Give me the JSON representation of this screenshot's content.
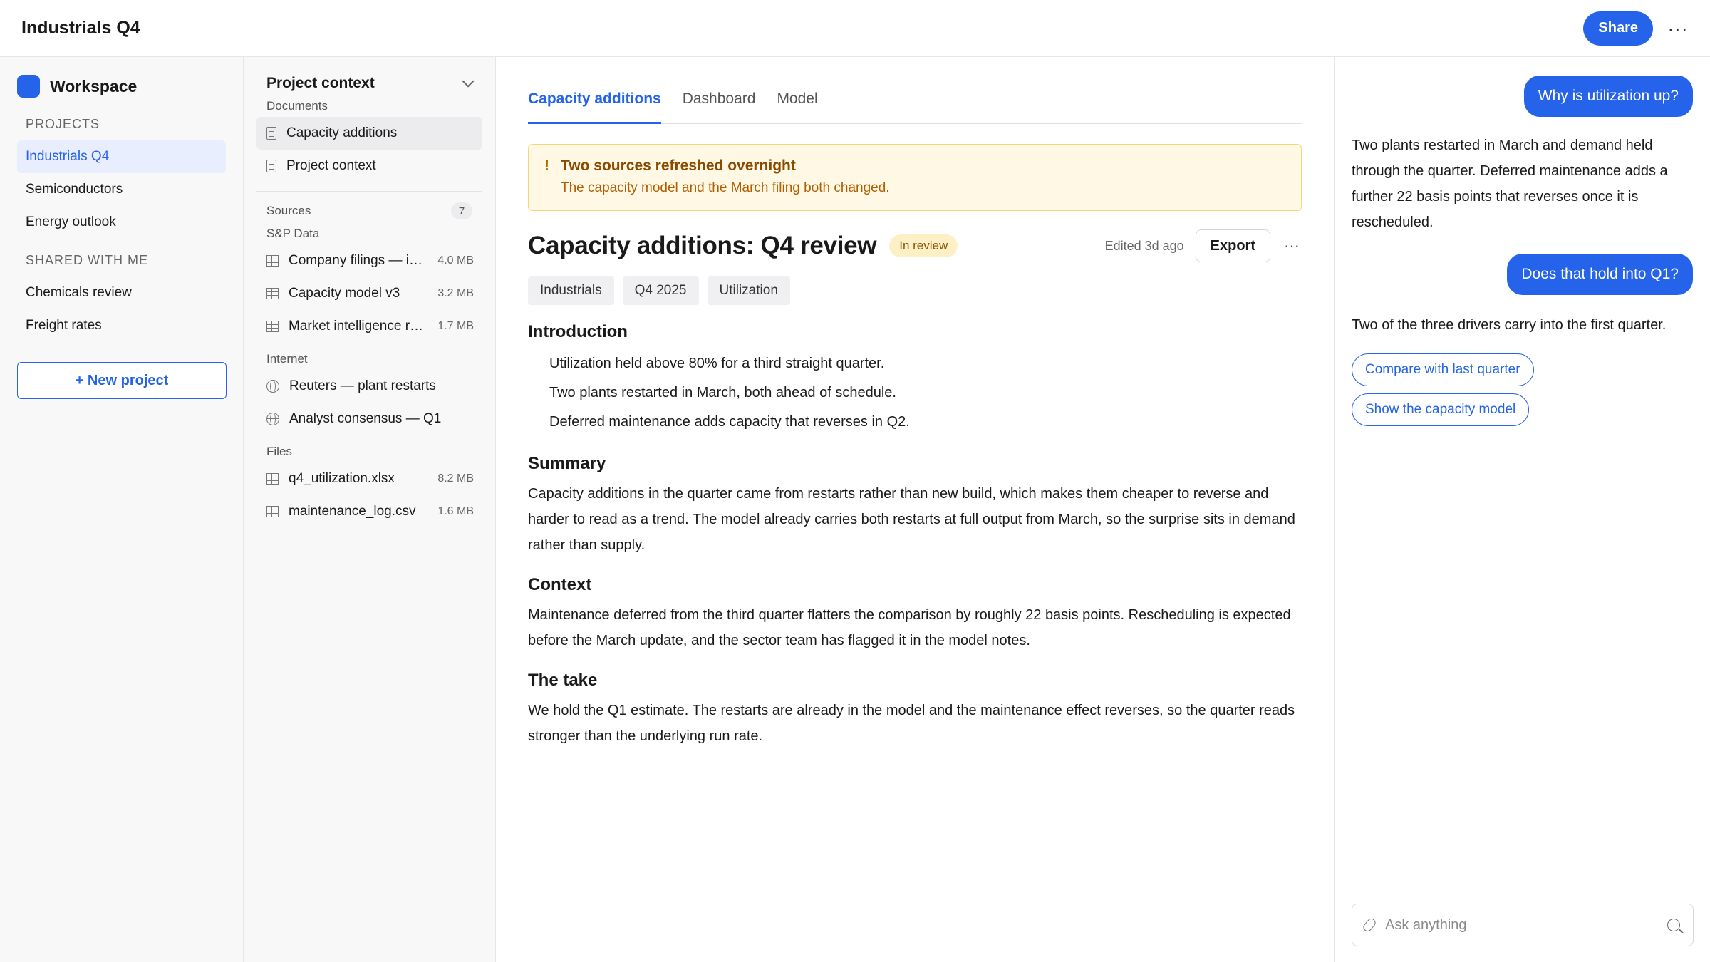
{
  "app": {
    "title": "Industrials Q4",
    "share_label": "Share",
    "more_label": "···"
  },
  "sidebar": {
    "workspace_name": "Workspace",
    "projects_heading": "PROJECTS",
    "projects": [
      "Industrials Q4",
      "Semiconductors",
      "Energy outlook"
    ],
    "shared_heading": "SHARED WITH ME",
    "shared": [
      "Chemicals review",
      "Freight rates"
    ],
    "new_project_label": "+ New project",
    "accent": "#2563eb"
  },
  "context": {
    "title": "Project context",
    "documents_label": "Documents",
    "documents": [
      "Capacity additions",
      "Project context"
    ],
    "sources_label": "Sources",
    "sources_count": "7",
    "sp_label": "S&P Data",
    "sp_items": [
      {
        "name": "Company filings — industrials",
        "size": "4.0 MB"
      },
      {
        "name": "Capacity model v3",
        "size": "3.2 MB"
      },
      {
        "name": "Market intelligence reports",
        "size": "1.7 MB"
      }
    ],
    "internet_label": "Internet",
    "internet_items": [
      "Reuters — plant restarts",
      "Analyst consensus — Q1"
    ],
    "files_label": "Files",
    "files": [
      {
        "name": "q4_utilization.xlsx",
        "size": "8.2 MB"
      },
      {
        "name": "maintenance_log.csv",
        "size": "1.6 MB"
      }
    ]
  },
  "main": {
    "tabs": [
      "Capacity additions",
      "Dashboard",
      "Model"
    ],
    "alert": {
      "icon": "!",
      "title": "Two sources refreshed overnight",
      "body": "The capacity model and the March filing both changed."
    },
    "doc_title": "Capacity additions: Q4 review",
    "status": "In review",
    "edited": "Edited 3d ago",
    "export_label": "Export",
    "more_label": "···",
    "tags": [
      "Industrials",
      "Q4 2025",
      "Utilization"
    ],
    "intro_heading": "Introduction",
    "intro_bullets": [
      "Utilization held above 80% for a third straight quarter.",
      "Two plants restarted in March, both ahead of schedule.",
      "Deferred maintenance adds capacity that reverses in Q2."
    ],
    "summary_heading": "Summary",
    "summary_text": "Capacity additions in the quarter came from restarts rather than new build, which makes them cheaper to reverse and harder to read as a trend. The model already carries both restarts at full output from March, so the surprise sits in demand rather than supply.",
    "context_heading": "Context",
    "context_text": "Maintenance deferred from the third quarter flatters the comparison by roughly 22 basis points. Rescheduling is expected before the March update, and the sector team has flagged it in the model notes.",
    "take_heading": "The take",
    "take_text": "We hold the Q1 estimate. The restarts are already in the model and the maintenance effect reverses, so the quarter reads stronger than the underlying run rate."
  },
  "chat": {
    "user_msg_1": "Why is utilization up?",
    "bot_msg_1": "Two plants restarted in March and demand held through the quarter. Deferred maintenance adds a further 22 basis points that reverses once it is rescheduled.",
    "user_msg_2": "Does that hold into Q1?",
    "bot_msg_2": "Two of the three drivers carry into the first quarter.",
    "suggestions": [
      "Compare with last quarter",
      "Show the capacity model"
    ],
    "input_placeholder": "Ask anything"
  }
}
